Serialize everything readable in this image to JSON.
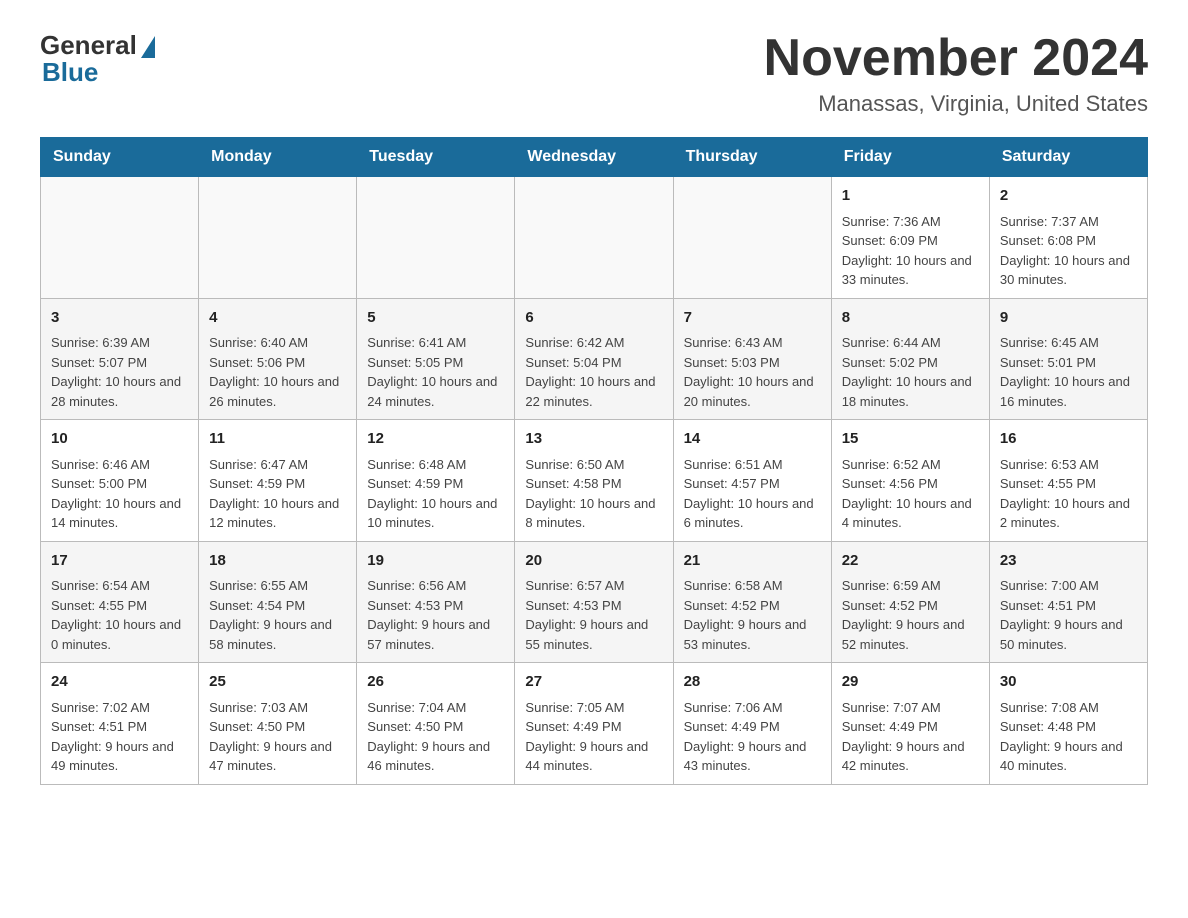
{
  "header": {
    "logo_general": "General",
    "logo_blue": "Blue",
    "month_title": "November 2024",
    "location": "Manassas, Virginia, United States"
  },
  "days_of_week": [
    "Sunday",
    "Monday",
    "Tuesday",
    "Wednesday",
    "Thursday",
    "Friday",
    "Saturday"
  ],
  "weeks": [
    {
      "days": [
        {
          "number": "",
          "info": ""
        },
        {
          "number": "",
          "info": ""
        },
        {
          "number": "",
          "info": ""
        },
        {
          "number": "",
          "info": ""
        },
        {
          "number": "",
          "info": ""
        },
        {
          "number": "1",
          "info": "Sunrise: 7:36 AM\nSunset: 6:09 PM\nDaylight: 10 hours and 33 minutes."
        },
        {
          "number": "2",
          "info": "Sunrise: 7:37 AM\nSunset: 6:08 PM\nDaylight: 10 hours and 30 minutes."
        }
      ]
    },
    {
      "days": [
        {
          "number": "3",
          "info": "Sunrise: 6:39 AM\nSunset: 5:07 PM\nDaylight: 10 hours and 28 minutes."
        },
        {
          "number": "4",
          "info": "Sunrise: 6:40 AM\nSunset: 5:06 PM\nDaylight: 10 hours and 26 minutes."
        },
        {
          "number": "5",
          "info": "Sunrise: 6:41 AM\nSunset: 5:05 PM\nDaylight: 10 hours and 24 minutes."
        },
        {
          "number": "6",
          "info": "Sunrise: 6:42 AM\nSunset: 5:04 PM\nDaylight: 10 hours and 22 minutes."
        },
        {
          "number": "7",
          "info": "Sunrise: 6:43 AM\nSunset: 5:03 PM\nDaylight: 10 hours and 20 minutes."
        },
        {
          "number": "8",
          "info": "Sunrise: 6:44 AM\nSunset: 5:02 PM\nDaylight: 10 hours and 18 minutes."
        },
        {
          "number": "9",
          "info": "Sunrise: 6:45 AM\nSunset: 5:01 PM\nDaylight: 10 hours and 16 minutes."
        }
      ]
    },
    {
      "days": [
        {
          "number": "10",
          "info": "Sunrise: 6:46 AM\nSunset: 5:00 PM\nDaylight: 10 hours and 14 minutes."
        },
        {
          "number": "11",
          "info": "Sunrise: 6:47 AM\nSunset: 4:59 PM\nDaylight: 10 hours and 12 minutes."
        },
        {
          "number": "12",
          "info": "Sunrise: 6:48 AM\nSunset: 4:59 PM\nDaylight: 10 hours and 10 minutes."
        },
        {
          "number": "13",
          "info": "Sunrise: 6:50 AM\nSunset: 4:58 PM\nDaylight: 10 hours and 8 minutes."
        },
        {
          "number": "14",
          "info": "Sunrise: 6:51 AM\nSunset: 4:57 PM\nDaylight: 10 hours and 6 minutes."
        },
        {
          "number": "15",
          "info": "Sunrise: 6:52 AM\nSunset: 4:56 PM\nDaylight: 10 hours and 4 minutes."
        },
        {
          "number": "16",
          "info": "Sunrise: 6:53 AM\nSunset: 4:55 PM\nDaylight: 10 hours and 2 minutes."
        }
      ]
    },
    {
      "days": [
        {
          "number": "17",
          "info": "Sunrise: 6:54 AM\nSunset: 4:55 PM\nDaylight: 10 hours and 0 minutes."
        },
        {
          "number": "18",
          "info": "Sunrise: 6:55 AM\nSunset: 4:54 PM\nDaylight: 9 hours and 58 minutes."
        },
        {
          "number": "19",
          "info": "Sunrise: 6:56 AM\nSunset: 4:53 PM\nDaylight: 9 hours and 57 minutes."
        },
        {
          "number": "20",
          "info": "Sunrise: 6:57 AM\nSunset: 4:53 PM\nDaylight: 9 hours and 55 minutes."
        },
        {
          "number": "21",
          "info": "Sunrise: 6:58 AM\nSunset: 4:52 PM\nDaylight: 9 hours and 53 minutes."
        },
        {
          "number": "22",
          "info": "Sunrise: 6:59 AM\nSunset: 4:52 PM\nDaylight: 9 hours and 52 minutes."
        },
        {
          "number": "23",
          "info": "Sunrise: 7:00 AM\nSunset: 4:51 PM\nDaylight: 9 hours and 50 minutes."
        }
      ]
    },
    {
      "days": [
        {
          "number": "24",
          "info": "Sunrise: 7:02 AM\nSunset: 4:51 PM\nDaylight: 9 hours and 49 minutes."
        },
        {
          "number": "25",
          "info": "Sunrise: 7:03 AM\nSunset: 4:50 PM\nDaylight: 9 hours and 47 minutes."
        },
        {
          "number": "26",
          "info": "Sunrise: 7:04 AM\nSunset: 4:50 PM\nDaylight: 9 hours and 46 minutes."
        },
        {
          "number": "27",
          "info": "Sunrise: 7:05 AM\nSunset: 4:49 PM\nDaylight: 9 hours and 44 minutes."
        },
        {
          "number": "28",
          "info": "Sunrise: 7:06 AM\nSunset: 4:49 PM\nDaylight: 9 hours and 43 minutes."
        },
        {
          "number": "29",
          "info": "Sunrise: 7:07 AM\nSunset: 4:49 PM\nDaylight: 9 hours and 42 minutes."
        },
        {
          "number": "30",
          "info": "Sunrise: 7:08 AM\nSunset: 4:48 PM\nDaylight: 9 hours and 40 minutes."
        }
      ]
    }
  ]
}
